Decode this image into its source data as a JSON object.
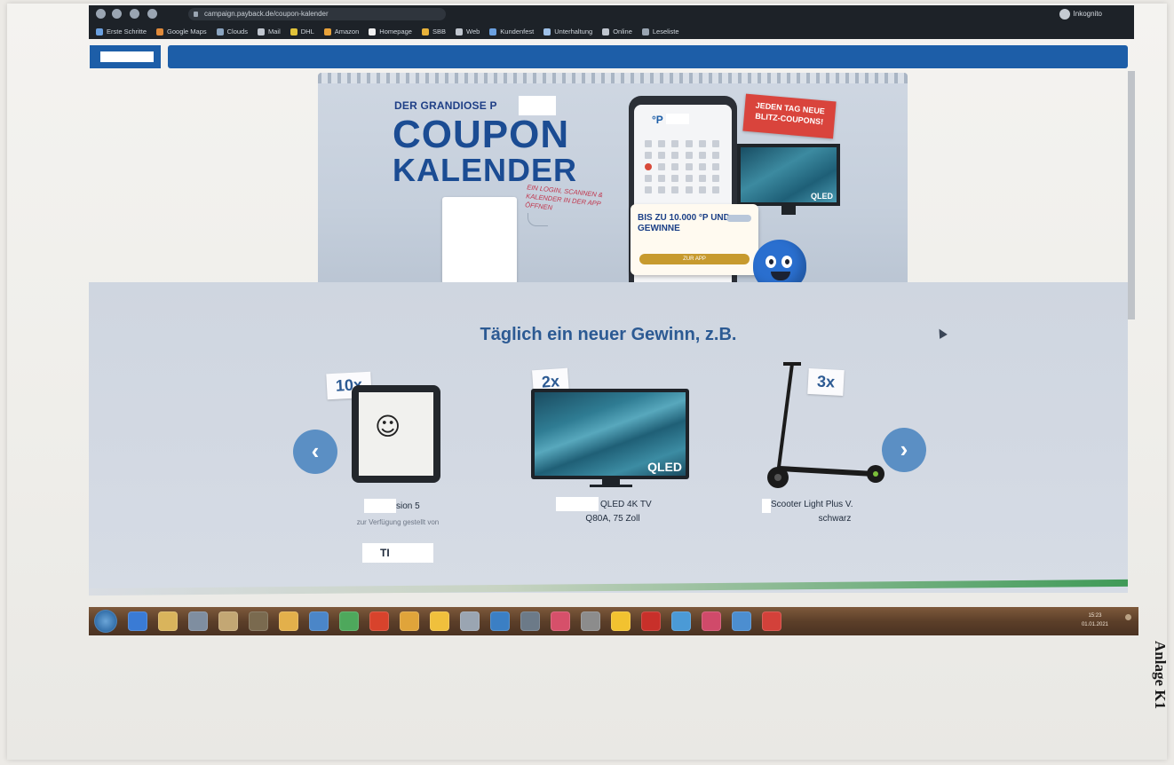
{
  "browser": {
    "url": "campaign.payback.de/coupon-kalender",
    "profile": "Inkognito",
    "bookmarks": [
      "Erste Schritte",
      "Google Maps",
      "Clouds",
      "Mail",
      "DHL",
      "Amazon",
      "Homepage",
      "SBB",
      "Web",
      "Kundenfest",
      "Unterhaltung",
      "Online",
      "Leseliste"
    ],
    "colors": {
      "chrome": "#1d2228"
    }
  },
  "banner": {
    "eyebrow": "DER GRANDIOSE P",
    "title_line1": "COUPON",
    "title_line2": "KALENDER",
    "hint": "EIN LOGIN, SCANNEN & KALENDER IN DER APP ÖFFNEN",
    "flash_badge": "JEDEN TAG NEUE BLITZ-COUPONS!",
    "promo_text": "BIS ZU 10.000 °P UND GEWINNE",
    "promo_button": "ZUR APP",
    "phone_logo": "°P",
    "tv_label": "QLED"
  },
  "prizes": {
    "title": "Täglich ein neuer Gewinn, z.B.",
    "prev_icon": "‹",
    "next_icon": "›",
    "items": [
      {
        "qty": "10x",
        "name": "sion 5",
        "sub": "zur Verfügung gestellt von",
        "sponsor": "TI"
      },
      {
        "qty": "2x",
        "name": "QLED 4K TV",
        "name2": "Q80A, 75 Zoll",
        "label": "QLED"
      },
      {
        "qty": "3x",
        "name": "Scooter Light Plus V.",
        "name2": "schwarz"
      }
    ]
  },
  "taskbar": {
    "clock_time": "15:23",
    "clock_date": "01.01.2021"
  },
  "annex": "Anlage K1"
}
